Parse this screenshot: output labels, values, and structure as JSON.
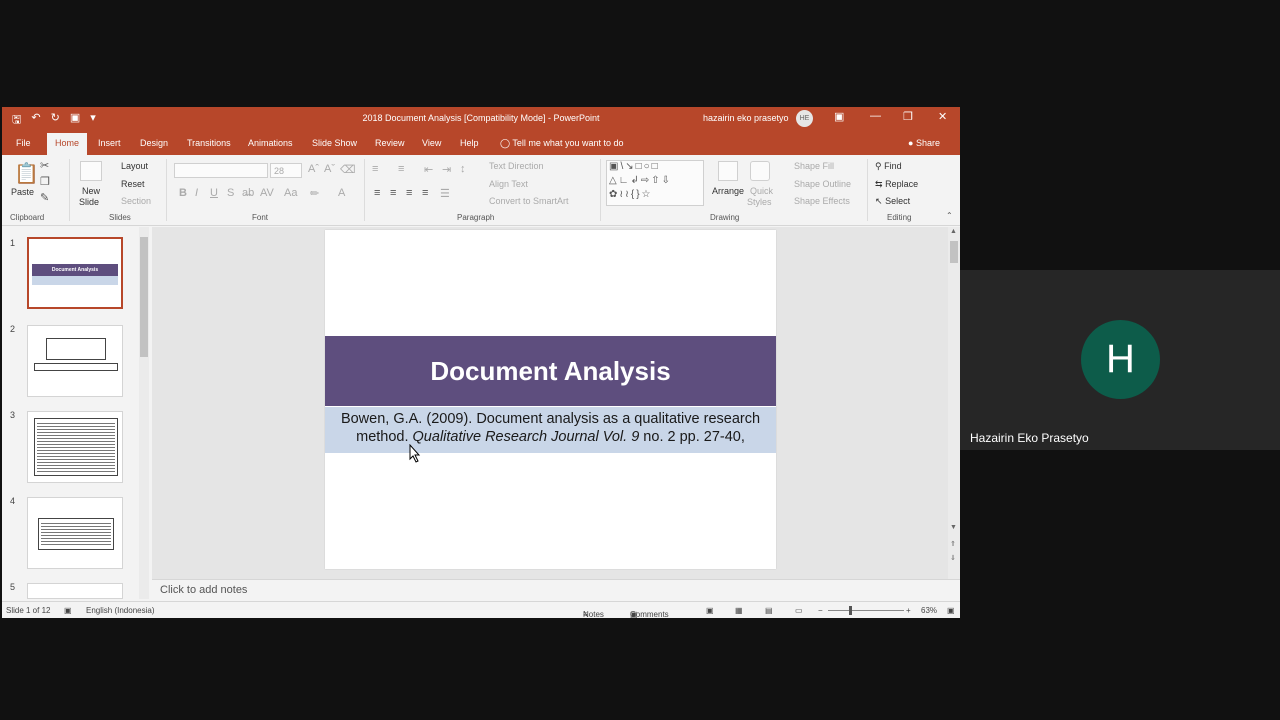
{
  "window": {
    "title": "2018 Document Analysis [Compatibility Mode]  -  PowerPoint",
    "user_name": "hazairin eko prasetyo",
    "user_initials": "HE"
  },
  "tabs": {
    "file": "File",
    "home": "Home",
    "insert": "Insert",
    "design": "Design",
    "transitions": "Transitions",
    "animations": "Animations",
    "slide_show": "Slide Show",
    "review": "Review",
    "view": "View",
    "help": "Help",
    "tell_me": "Tell me what you want to do",
    "share": "Share"
  },
  "ribbon": {
    "clipboard": {
      "label": "Clipboard",
      "paste": "Paste"
    },
    "slides": {
      "label": "Slides",
      "new_slide_1": "New",
      "new_slide_2": "Slide",
      "layout": "Layout",
      "reset": "Reset",
      "section": "Section"
    },
    "font": {
      "label": "Font",
      "size": "28"
    },
    "paragraph": {
      "label": "Paragraph",
      "text_direction": "Text Direction",
      "align_text": "Align Text",
      "convert": "Convert to SmartArt"
    },
    "drawing": {
      "label": "Drawing",
      "arrange": "Arrange",
      "quick_styles_1": "Quick",
      "quick_styles_2": "Styles",
      "shape_fill": "Shape Fill",
      "shape_outline": "Shape Outline",
      "shape_effects": "Shape Effects"
    },
    "editing": {
      "label": "Editing",
      "find": "Find",
      "replace": "Replace",
      "select": "Select"
    }
  },
  "thumbnails": {
    "numbers": [
      "1",
      "2",
      "3",
      "4",
      "5"
    ],
    "slide1_title": "Document Analysis"
  },
  "slide": {
    "title": "Document Analysis",
    "citation_plain_1": "Bowen, G.A. (2009). Document analysis as a qualitative research",
    "citation_plain_2": "method. ",
    "citation_italic": "Qualitative Research Journal Vol. 9",
    "citation_plain_3": " no. 2 pp. 27-40,"
  },
  "notes": {
    "placeholder": "Click to add notes"
  },
  "status": {
    "slide_counter": "Slide 1 of 12",
    "language": "English (Indonesia)",
    "notes": "Notes",
    "comments": "Comments",
    "zoom": "63%"
  },
  "participant": {
    "initial": "H",
    "name": "Hazairin Eko Prasetyo",
    "avatar_color": "#0d5c4a"
  },
  "colors": {
    "accent": "#b7472a",
    "title_band": "#5e4e7e",
    "subtitle_band": "#c9d6e8"
  }
}
